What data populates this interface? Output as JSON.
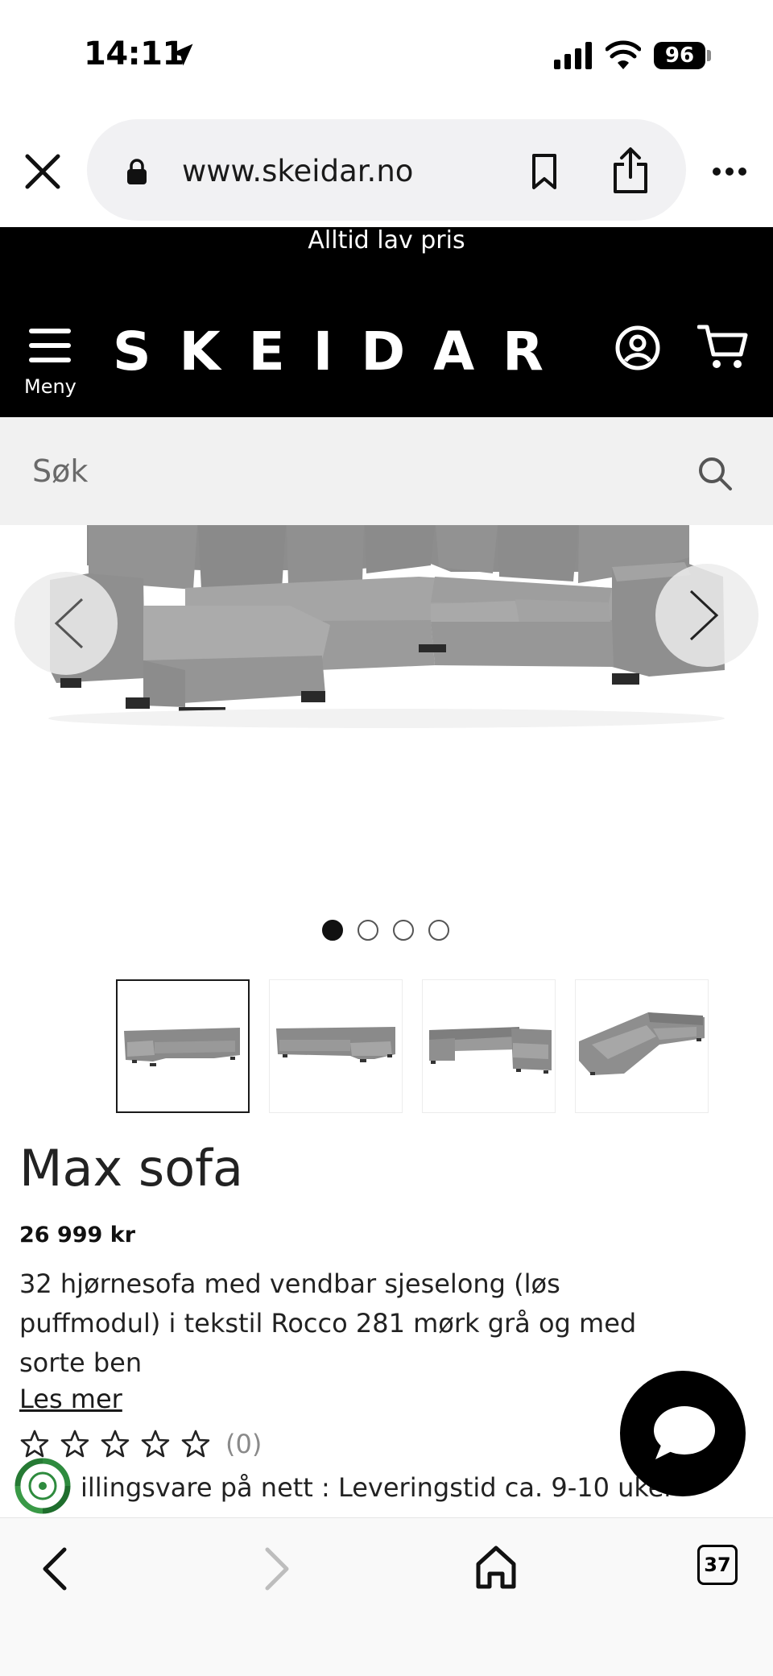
{
  "status_bar": {
    "time": "14:11",
    "battery": "96",
    "icons": [
      "location-arrow-icon",
      "cellular-signal-icon",
      "wifi-icon",
      "battery-icon"
    ]
  },
  "browser": {
    "url": "www.skeidar.no",
    "icons": [
      "close-icon",
      "lock-icon",
      "bookmark-icon",
      "share-icon",
      "more-icon"
    ]
  },
  "site": {
    "promo": "Alltid lav pris",
    "menu_label": "Meny",
    "brand": "SKEIDAR",
    "search_placeholder": "Søk"
  },
  "gallery": {
    "image_count": 4,
    "active_index": 0,
    "thumbnail_count": 4
  },
  "product": {
    "title": "Max sofa",
    "price": "26 999 kr",
    "description": "32 hjørnesofa med vendbar sjeselong (løs puffmodul) i tekstil Rocco 281 mørk grå og med sorte ben",
    "read_more": "Les mer",
    "rating_stars": 0,
    "rating_max": 5,
    "review_count": "(0)",
    "delivery": "illingsvare på nett : Leveringstid ca. 9-10 uker"
  },
  "bottom_toolbar": {
    "tab_count": "37",
    "icons": [
      "back-icon",
      "forward-icon",
      "home-icon",
      "tabs-icon"
    ]
  },
  "colors": {
    "header_bg": "#000000",
    "search_bg": "#f1f1f1",
    "sofa_fabric": "#9a9a9a",
    "text": "#222222"
  }
}
